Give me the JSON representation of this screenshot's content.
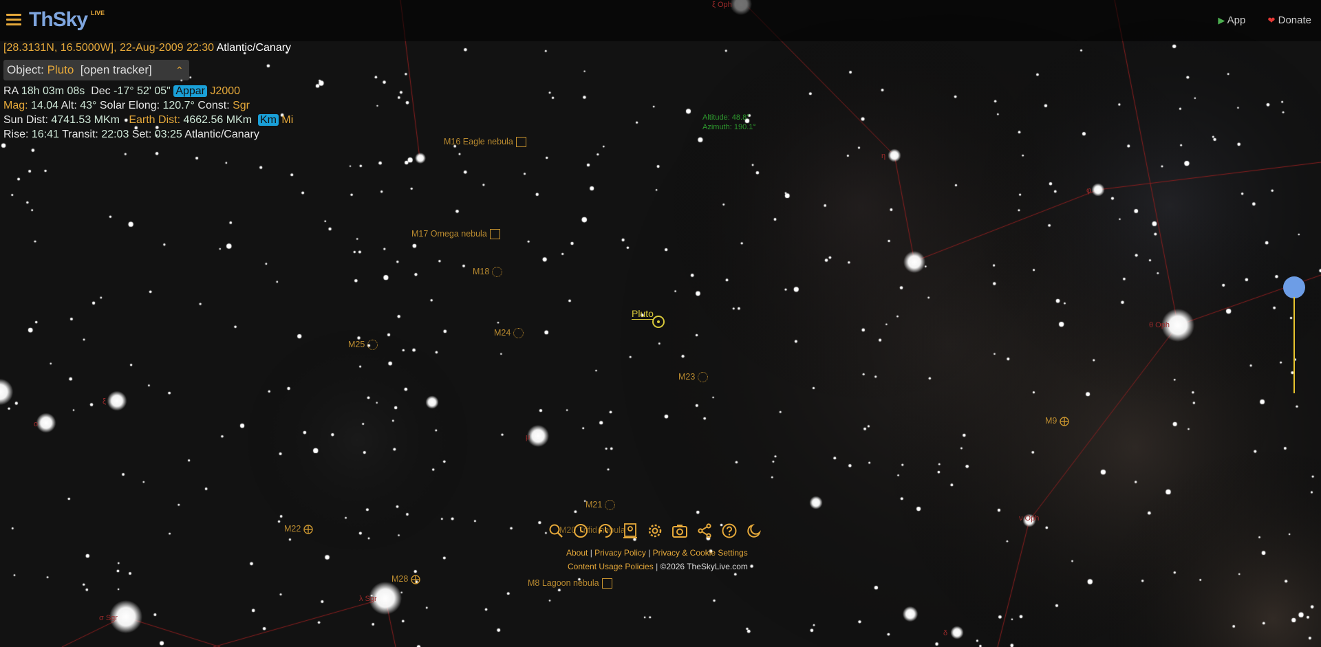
{
  "header": {
    "logo_text": "ThSky",
    "logo_badge": "LIVE",
    "app_label": "App",
    "donate_label": "Donate",
    "icons": {
      "menu": "hamburger-menu-icon",
      "app": "play-store-icon",
      "donate": "heart-icon"
    }
  },
  "location_line": {
    "coords": "[28.3131N, 16.5000W], 22-Aug-2009 22:30",
    "timezone": "Atlantic/Canary"
  },
  "object": {
    "label": "Object:",
    "name": "Pluto",
    "tracker": "[open tracker]"
  },
  "details": {
    "ra_label": "RA",
    "ra_value": "18h 03m 08s",
    "dec_label": "Dec",
    "dec_value": "-17° 52' 05\"",
    "appar_label": "Appar",
    "epoch_label": "J2000",
    "mag_label": "Mag:",
    "mag_value": "14.04",
    "alt_label": "Alt:",
    "alt_value": "43°",
    "elong_label": "Solar Elong:",
    "elong_value": "120.7°",
    "const_label": "Const:",
    "const_value": "Sgr",
    "sun_dist_label": "Sun Dist:",
    "sun_dist_value": "4741.53 MKm",
    "earth_dist_label": "Earth Dist:",
    "earth_dist_value": "4662.56 MKm",
    "km_label": "Km",
    "mi_label": "Mi",
    "rise_label": "Rise:",
    "rise_value": "16:41",
    "transit_label": "Transit:",
    "transit_value": "22:03",
    "set_label": "Set:",
    "set_value": "03:25",
    "set_tz": "Atlantic/Canary"
  },
  "cursor_readout": {
    "altitude": "Altitude: 48.8°",
    "azimuth": "Azimuth: 190.1°"
  },
  "sky_labels": {
    "m16": "M16 Eagle nebula",
    "m17": "M17 Omega nebula",
    "m18": "M18",
    "m24": "M24",
    "m25": "M25",
    "m23": "M23",
    "m21": "M21",
    "m22": "M22",
    "m28": "M28",
    "m8": "M8 Lagoon nebula",
    "m9": "M9",
    "m20": "M20 Trifid nebula",
    "pluto": "Pluto"
  },
  "star_labels": {
    "xi_oph": "ξ Oph",
    "mu": "μ",
    "xi": "ξ",
    "omicron": "ο",
    "lambda_sgr": "λ Sgr",
    "sigma_sgr": "σ Sgr",
    "theta_oph": "θ Oph",
    "nu_oph": "ν Oph",
    "eta_oph": "η",
    "phi": "φ",
    "delta": "δ"
  },
  "toolbar": {
    "icons": [
      "search-icon",
      "clock-icon",
      "time-speed-icon",
      "location-icon",
      "settings-icon",
      "camera-icon",
      "share-icon",
      "help-icon",
      "night-mode-icon"
    ]
  },
  "footer": {
    "about": "About",
    "privacy": "Privacy Policy",
    "cookies": "Privacy & Cookie Settings",
    "content_policies": "Content Usage Policies",
    "copyright": "©2026 TheSkyLive.com"
  },
  "colors": {
    "accent": "#e6a93a",
    "value_text": "#cfe8d8",
    "chip": "#1aa0d8",
    "constellation_line": "#8b1f1f",
    "pluto": "#d8c93a",
    "slider": "#6d9de6"
  }
}
